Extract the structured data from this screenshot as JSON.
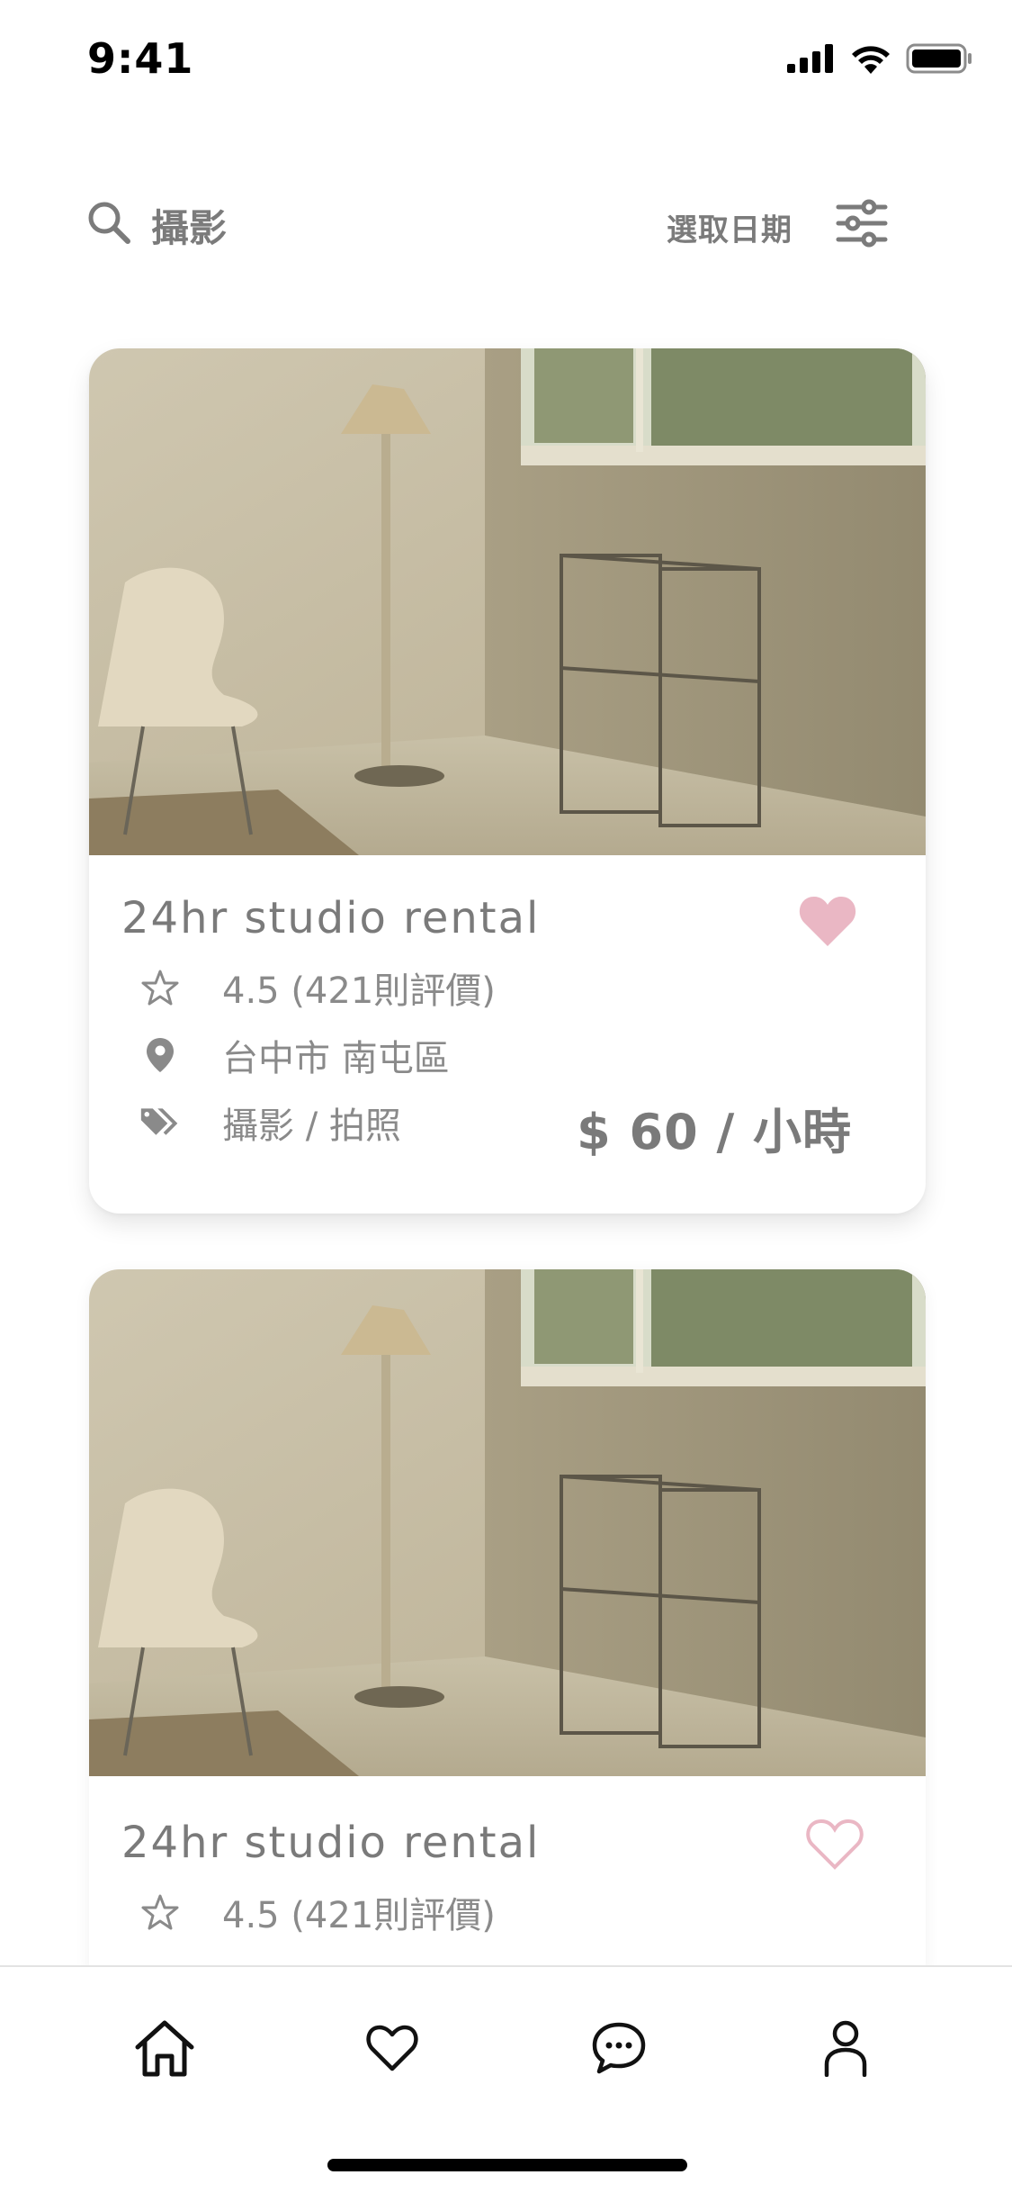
{
  "status_bar": {
    "time": "9:41"
  },
  "search": {
    "query": "攝影",
    "date_label": "選取日期"
  },
  "listings": [
    {
      "title": "24hr studio rental",
      "favorited": true,
      "rating": "4.5 (421則評價)",
      "location": "台中市 南屯區",
      "tags": "攝影 / 拍照",
      "price": "$ 60 / 小時"
    },
    {
      "title": "24hr studio rental",
      "favorited": false,
      "rating": "4.5 (421則評價)"
    }
  ],
  "nav": {
    "items": [
      {
        "icon": "home-icon"
      },
      {
        "icon": "heart-icon"
      },
      {
        "icon": "chat-icon"
      },
      {
        "icon": "profile-icon"
      }
    ]
  },
  "colors": {
    "text": "#7a7a7a",
    "heart": "#eab7c4",
    "photo_wall": "#c9bfa4"
  }
}
